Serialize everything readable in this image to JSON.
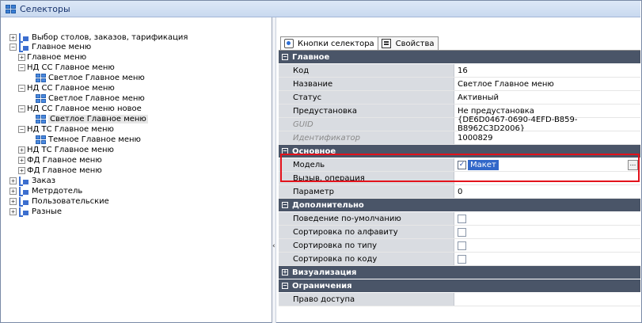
{
  "window": {
    "title": "Селекторы"
  },
  "tree": {
    "items": [
      {
        "label": "Выбор столов, заказов, тарификация",
        "icon": "layout-icon"
      },
      {
        "label": "Главное меню",
        "icon": "layout-icon"
      },
      {
        "label": "Главное меню",
        "icon": "folder-grid-icon"
      },
      {
        "label": "НД СС Главное меню",
        "icon": "folder-grid-icon"
      },
      {
        "label": "Светлое Главное меню",
        "icon": "grid-icon"
      },
      {
        "label": "НД СС Главное меню",
        "icon": "folder-grid-icon"
      },
      {
        "label": "Светлое Главное меню",
        "icon": "grid-icon"
      },
      {
        "label": "НД СС Главное меню новое",
        "icon": "folder-grid-icon"
      },
      {
        "label": "Светлое Главное меню",
        "icon": "grid-icon"
      },
      {
        "label": "НД ТС Главное меню",
        "icon": "folder-grid-icon"
      },
      {
        "label": "Темное Главное меню",
        "icon": "grid-icon"
      },
      {
        "label": "НД ТС Главное меню",
        "icon": "folder-grid-icon"
      },
      {
        "label": "ФД Главное меню",
        "icon": "folder-grid-icon"
      },
      {
        "label": "ФД Главное меню",
        "icon": "folder-grid-icon"
      },
      {
        "label": "Заказ",
        "icon": "layout-icon"
      },
      {
        "label": "Метрдотель",
        "icon": "layout-icon"
      },
      {
        "label": "Пользовательские",
        "icon": "layout-icon"
      },
      {
        "label": "Разные",
        "icon": "layout-icon"
      }
    ]
  },
  "tabs": [
    {
      "label": "Кнопки селектора",
      "icon": "selector-buttons-icon"
    },
    {
      "label": "Свойства",
      "icon": "properties-icon",
      "active": true
    }
  ],
  "properties": {
    "main": {
      "header": "Главное",
      "rows": [
        {
          "name": "Код",
          "value": "16"
        },
        {
          "name": "Название",
          "value": "Светлое Главное меню"
        },
        {
          "name": "Статус",
          "value": "Активный"
        },
        {
          "name": "Предустановка",
          "value": "Не предустановка"
        },
        {
          "name": "GUID",
          "value": "{DE6D0467-0690-4EFD-B859-B8962C3D2006}"
        },
        {
          "name": "Идентификатор",
          "value": "1000829"
        }
      ]
    },
    "basic": {
      "header": "Основное",
      "model_name": "Модель",
      "model_value": "Макет",
      "model_checked": true,
      "rows": [
        {
          "name": "Вызыв. операция",
          "value": ""
        },
        {
          "name": "Параметр",
          "value": "0"
        }
      ]
    },
    "additional": {
      "header": "Дополнительно",
      "rows": [
        {
          "name": "Поведение по-умолчанию",
          "checked": false
        },
        {
          "name": "Сортировка по алфавиту",
          "checked": false
        },
        {
          "name": "Сортировка по типу",
          "checked": false
        },
        {
          "name": "Сортировка по коду",
          "checked": false
        }
      ]
    },
    "visualization": {
      "header": "Визуализация"
    },
    "restrictions": {
      "header": "Ограничения",
      "rows": [
        {
          "name": "Право доступа",
          "value": ""
        }
      ]
    }
  },
  "colors": {
    "category_bg": "#4a5568",
    "highlight": "#e3121b",
    "selection": "#3167c9"
  }
}
